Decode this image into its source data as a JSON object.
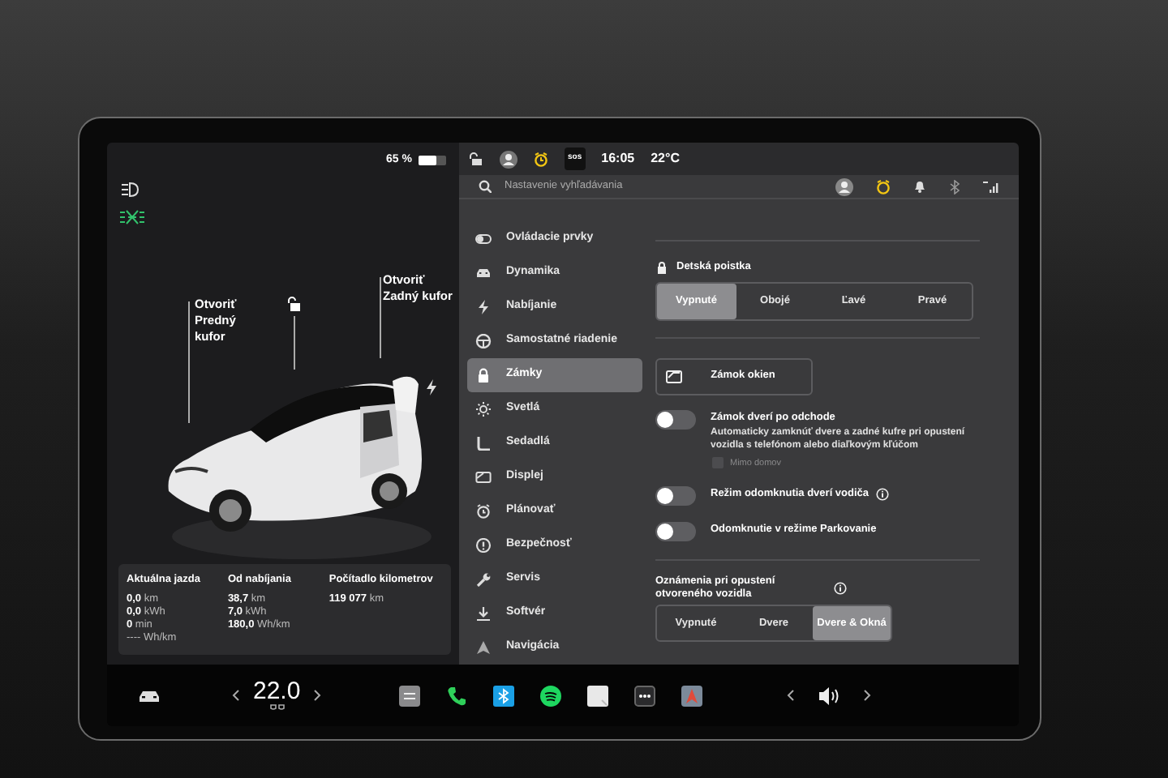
{
  "left_panel": {
    "battery": {
      "reading": "65 %",
      "level": 0.65
    },
    "trunk_buttons": [
      {
        "text": "Otvoriť\nPredný\nkufor"
      },
      {
        "text": "Otvoriť\nZadný kufor"
      }
    ],
    "stats": [
      {
        "title": "Aktuálna jazda",
        "lines": [
          "**0,0** km",
          "**0,0** kWh",
          "**0** min",
          "---- Wh/km"
        ]
      },
      {
        "title": "Od nabíjania",
        "lines": [
          "**38,7** km",
          "**7,0** kWh",
          "**180,0** Wh/km"
        ]
      },
      {
        "title": "Počítadlo kilometrov",
        "lines": [
          "**119 077** km"
        ]
      }
    ]
  },
  "status_bar": {
    "sos": "sos",
    "time": "16:05",
    "temperature": "22°C"
  },
  "settings": {
    "search": {
      "placeholder": "Nastavenie vyhľadávania"
    },
    "sidebar": {
      "items": [
        {
          "label": "Ovládacie prvky",
          "selected": false
        },
        {
          "label": "Dynamika",
          "selected": false
        },
        {
          "label": "Nabíjanie",
          "selected": false
        },
        {
          "label": "Samostatné riadenie",
          "selected": false
        },
        {
          "label": "Zámky",
          "selected": true
        },
        {
          "label": "Svetlá",
          "selected": false
        },
        {
          "label": "Sedadlá",
          "selected": false
        },
        {
          "label": "Displej",
          "selected": false
        },
        {
          "label": "Plánovať",
          "selected": false
        },
        {
          "label": "Bezpečnosť",
          "selected": false
        },
        {
          "label": "Servis",
          "selected": false
        },
        {
          "label": "Softvér",
          "selected": false
        },
        {
          "label": "Navigácia",
          "selected": false
        }
      ]
    },
    "child_lock": {
      "title": "Detská poistka",
      "options": [
        {
          "label": "Vypnuté",
          "selected": true
        },
        {
          "label": "Obojé",
          "selected": false
        },
        {
          "label": "Ľavé",
          "selected": false
        },
        {
          "label": "Pravé",
          "selected": false
        }
      ]
    },
    "window_lock_button": "Zámok okien",
    "toggles": [
      {
        "title": "Zámok dverí po odchode",
        "description": "Automaticky zamknúť dvere a zadné kufre pri opustení vozidla s telefónom alebo diaľkovým kľúčom",
        "on": false,
        "info": false,
        "checkbox": {
          "label": "Mimo domov",
          "checked": false,
          "disabled": true
        }
      },
      {
        "title": "Režim odomknutia dverí vodiča",
        "on": false,
        "info": true
      },
      {
        "title": "Odomknutie v režime Parkovanie",
        "on": false,
        "info": false
      }
    ],
    "open_vehicle_alert": {
      "title": "Oznámenia pri opustení otvoreného vozidla",
      "info": true,
      "options": [
        {
          "label": "Vypnuté",
          "selected": false
        },
        {
          "label": "Dvere",
          "selected": false
        },
        {
          "label": "Dvere & Okná",
          "selected": true
        }
      ]
    }
  },
  "taskbar": {
    "temperature": "22.0"
  }
}
